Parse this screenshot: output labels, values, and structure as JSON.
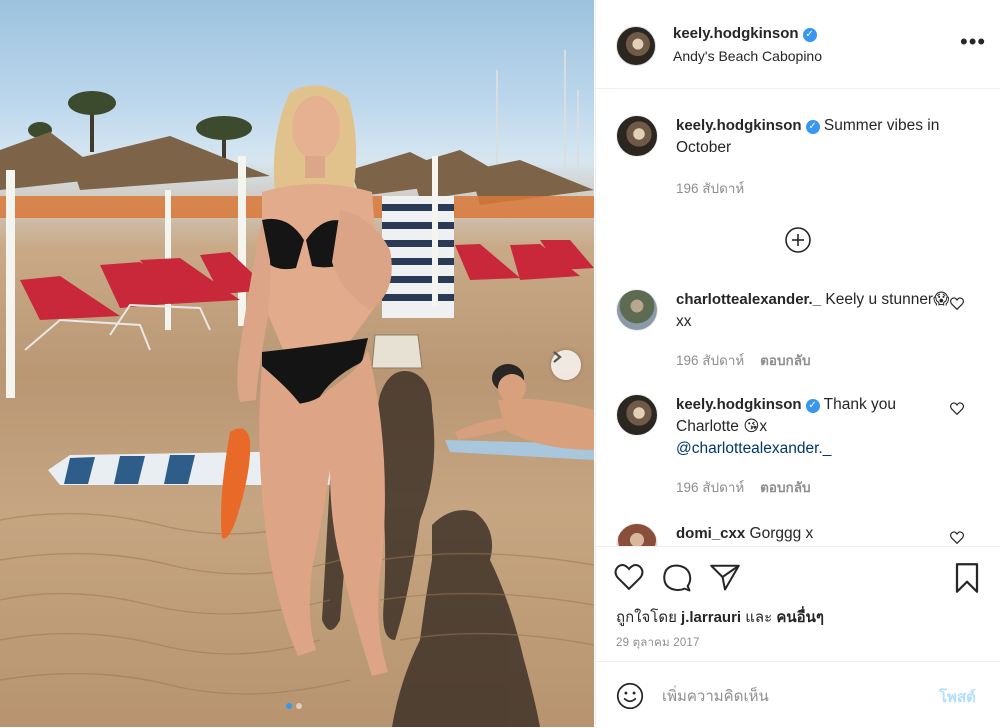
{
  "post": {
    "username": "keely.hodgkinson",
    "location": "Andy's Beach Cabopino"
  },
  "caption": {
    "username": "keely.hodgkinson",
    "text": "Summer vibes in October",
    "age": "196 สัปดาห์"
  },
  "comments": [
    {
      "username": "charlottealexander._",
      "text": "Keely u stunner😱xx",
      "age": "196 สัปดาห์",
      "reply": "ตอบกลับ"
    },
    {
      "username": "keely.hodgkinson",
      "text": "Thank you Charlotte 😘x",
      "mention": "@charlottealexander._",
      "age": "196 สัปดาห์",
      "reply": "ตอบกลับ"
    },
    {
      "username": "domi_cxx",
      "text": "Gorggg x"
    }
  ],
  "likes": {
    "prefix": "ถูกใจโดย",
    "user": "j.larrauri",
    "and": "และ",
    "others": "คนอื่นๆ"
  },
  "date": "29 ตุลาคม 2017",
  "add_comment": {
    "placeholder": "เพิ่มความคิดเห็น",
    "post_label": "โพสต์"
  },
  "carousel": {
    "count": 2,
    "active_index": 0
  },
  "icons": {
    "verified": "verified-badge-icon",
    "more": "more-options-icon",
    "add": "plus-circle-icon",
    "like": "heart-icon",
    "comment": "comment-bubble-icon",
    "share": "paper-plane-icon",
    "save": "bookmark-icon",
    "emoji": "smiley-icon",
    "next": "chevron-right-icon"
  },
  "colors": {
    "verified": "#3897f0",
    "link": "#00376b",
    "muted": "#8e8e8e",
    "post_button": "#b2dffc"
  }
}
